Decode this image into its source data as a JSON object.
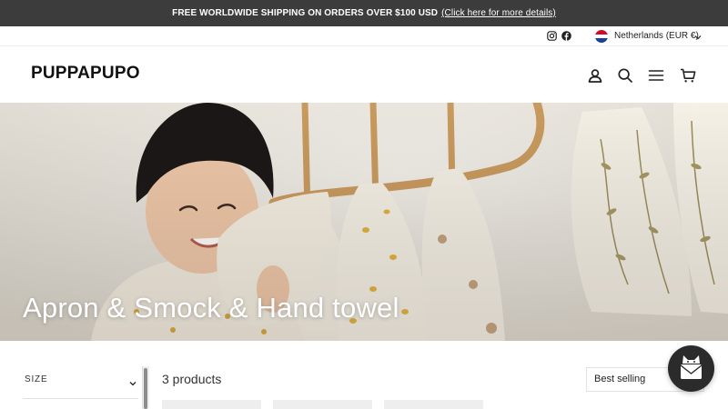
{
  "announcement": {
    "text": "FREE WORLDWIDE SHIPPING ON ORDERS OVER $100 USD",
    "link": "(Click here for more details)"
  },
  "utility": {
    "social": [
      "instagram-icon",
      "facebook-icon"
    ],
    "locale": "Netherlands (EUR €)",
    "flag_colors": [
      "#c8102e",
      "#ffffff",
      "#1f3f8f"
    ]
  },
  "header": {
    "logo": "PUPPAPUPO",
    "icons": [
      "account-icon",
      "search-icon",
      "menu-icon",
      "cart-icon"
    ]
  },
  "hero": {
    "title": "Apron & Smock & Hand towel"
  },
  "filters": {
    "size_label": "SIZE"
  },
  "products": {
    "count_label": "3 products",
    "sort_label": "Best selling"
  },
  "colors": {
    "announcement_bg": "#3d3c3d",
    "chat_bg": "#2b2b2b"
  }
}
